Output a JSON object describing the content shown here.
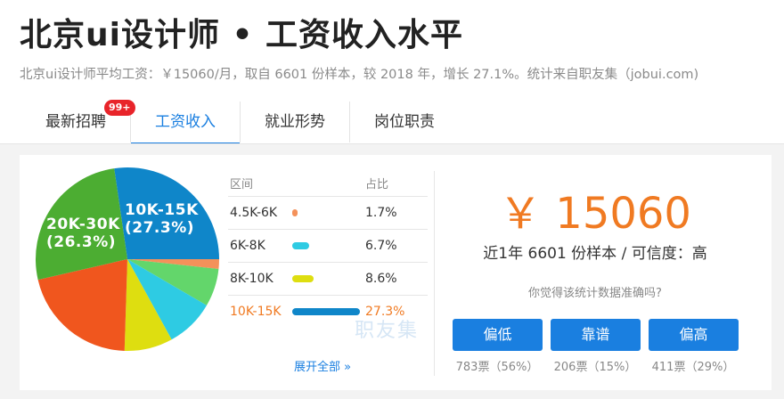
{
  "header": {
    "title": "北京ui设计师 • 工资收入水平",
    "subtitle": "北京ui设计师平均工资：￥15060/月，取自 6601 份样本，较 2018 年，增长 27.1%。统计来自职友集（jobui.com)"
  },
  "tabs": [
    {
      "label": "最新招聘",
      "badge": "99+"
    },
    {
      "label": "工资收入",
      "active": true
    },
    {
      "label": "就业形势"
    },
    {
      "label": "岗位职责"
    }
  ],
  "chart_data": {
    "type": "pie",
    "slices": [
      {
        "label": "10K-15K",
        "value": 27.3,
        "color": "#0f86c9",
        "text": "10K-15K",
        "pct_text": "(27.3%)"
      },
      {
        "label": "4.5K-6K",
        "value": 1.7,
        "color": "#f4915a"
      },
      {
        "label": "6K-8K",
        "value": 6.7,
        "color": "#63d66b"
      },
      {
        "label": "8K-10K",
        "value": 8.6,
        "color": "#2ecbe3"
      },
      {
        "label": "other-1",
        "value": 8.5,
        "color": "#dede10"
      },
      {
        "label": "other-2",
        "value": 20.9,
        "color": "#f0561e"
      },
      {
        "label": "20K-30K",
        "value": 26.3,
        "color": "#4cad32",
        "text": "20K-30K",
        "pct_text": "(26.3%)"
      }
    ]
  },
  "distribution": {
    "col_range": "区间",
    "col_pct": "占比",
    "rows": [
      {
        "range": "4.5K-6K",
        "pct": "1.7%",
        "value": 1.7,
        "color": "#f4915a"
      },
      {
        "range": "6K-8K",
        "pct": "6.7%",
        "value": 6.7,
        "color": "#2ecbe3"
      },
      {
        "range": "8K-10K",
        "pct": "8.6%",
        "value": 8.6,
        "color": "#dede10"
      },
      {
        "range": "10K-15K",
        "pct": "27.3%",
        "value": 27.3,
        "color": "#0f86c9",
        "highlight": true
      }
    ],
    "expand_label": "展开全部 »"
  },
  "watermark": "职友集",
  "summary": {
    "salary": "￥ 15060",
    "sample_text": "近1年 6601 份样本 / 可信度：高",
    "question": "你觉得该统计数据准确吗?"
  },
  "votes": [
    {
      "label": "偏低",
      "count": "783票（56%）"
    },
    {
      "label": "靠谱",
      "count": "206票（15%）"
    },
    {
      "label": "偏高",
      "count": "411票（29%）"
    }
  ],
  "colors": {
    "accent": "#1a7fe0",
    "salary": "#f07a22",
    "badge": "#e8242a"
  }
}
